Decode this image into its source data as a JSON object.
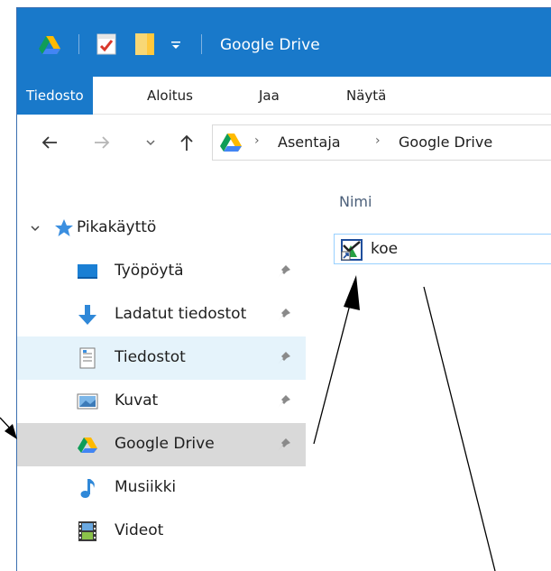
{
  "window": {
    "title": "Google Drive",
    "accent_color": "#1979ca"
  },
  "titlebar": {
    "icons": [
      "google-drive-icon",
      "properties-check-icon",
      "folder-icon",
      "customize-dropdown-icon"
    ]
  },
  "ribbon": {
    "tabs": [
      {
        "label": "Tiedosto",
        "active": true
      },
      {
        "label": "Aloitus"
      },
      {
        "label": "Jaa"
      },
      {
        "label": "Näytä"
      }
    ]
  },
  "address": {
    "crumbs": [
      "Asentaja",
      "Google Drive"
    ]
  },
  "sidebar": {
    "quick_access_label": "Pikakäyttö",
    "items": [
      {
        "label": "Työpöytä",
        "icon": "desktop-icon",
        "pinned": true
      },
      {
        "label": "Ladatut tiedostot",
        "icon": "download-arrow-icon",
        "pinned": true
      },
      {
        "label": "Tiedostot",
        "icon": "document-icon",
        "pinned": true,
        "state": "hover"
      },
      {
        "label": "Kuvat",
        "icon": "pictures-icon",
        "pinned": true
      },
      {
        "label": "Google Drive",
        "icon": "google-drive-icon",
        "pinned": true,
        "state": "selected"
      },
      {
        "label": "Musiikki",
        "icon": "music-note-icon",
        "pinned": false
      },
      {
        "label": "Videot",
        "icon": "film-icon",
        "pinned": false
      }
    ]
  },
  "content": {
    "column_header": "Nimi",
    "files": [
      {
        "name": "koe",
        "icon": "shortcut-file-icon"
      }
    ]
  }
}
